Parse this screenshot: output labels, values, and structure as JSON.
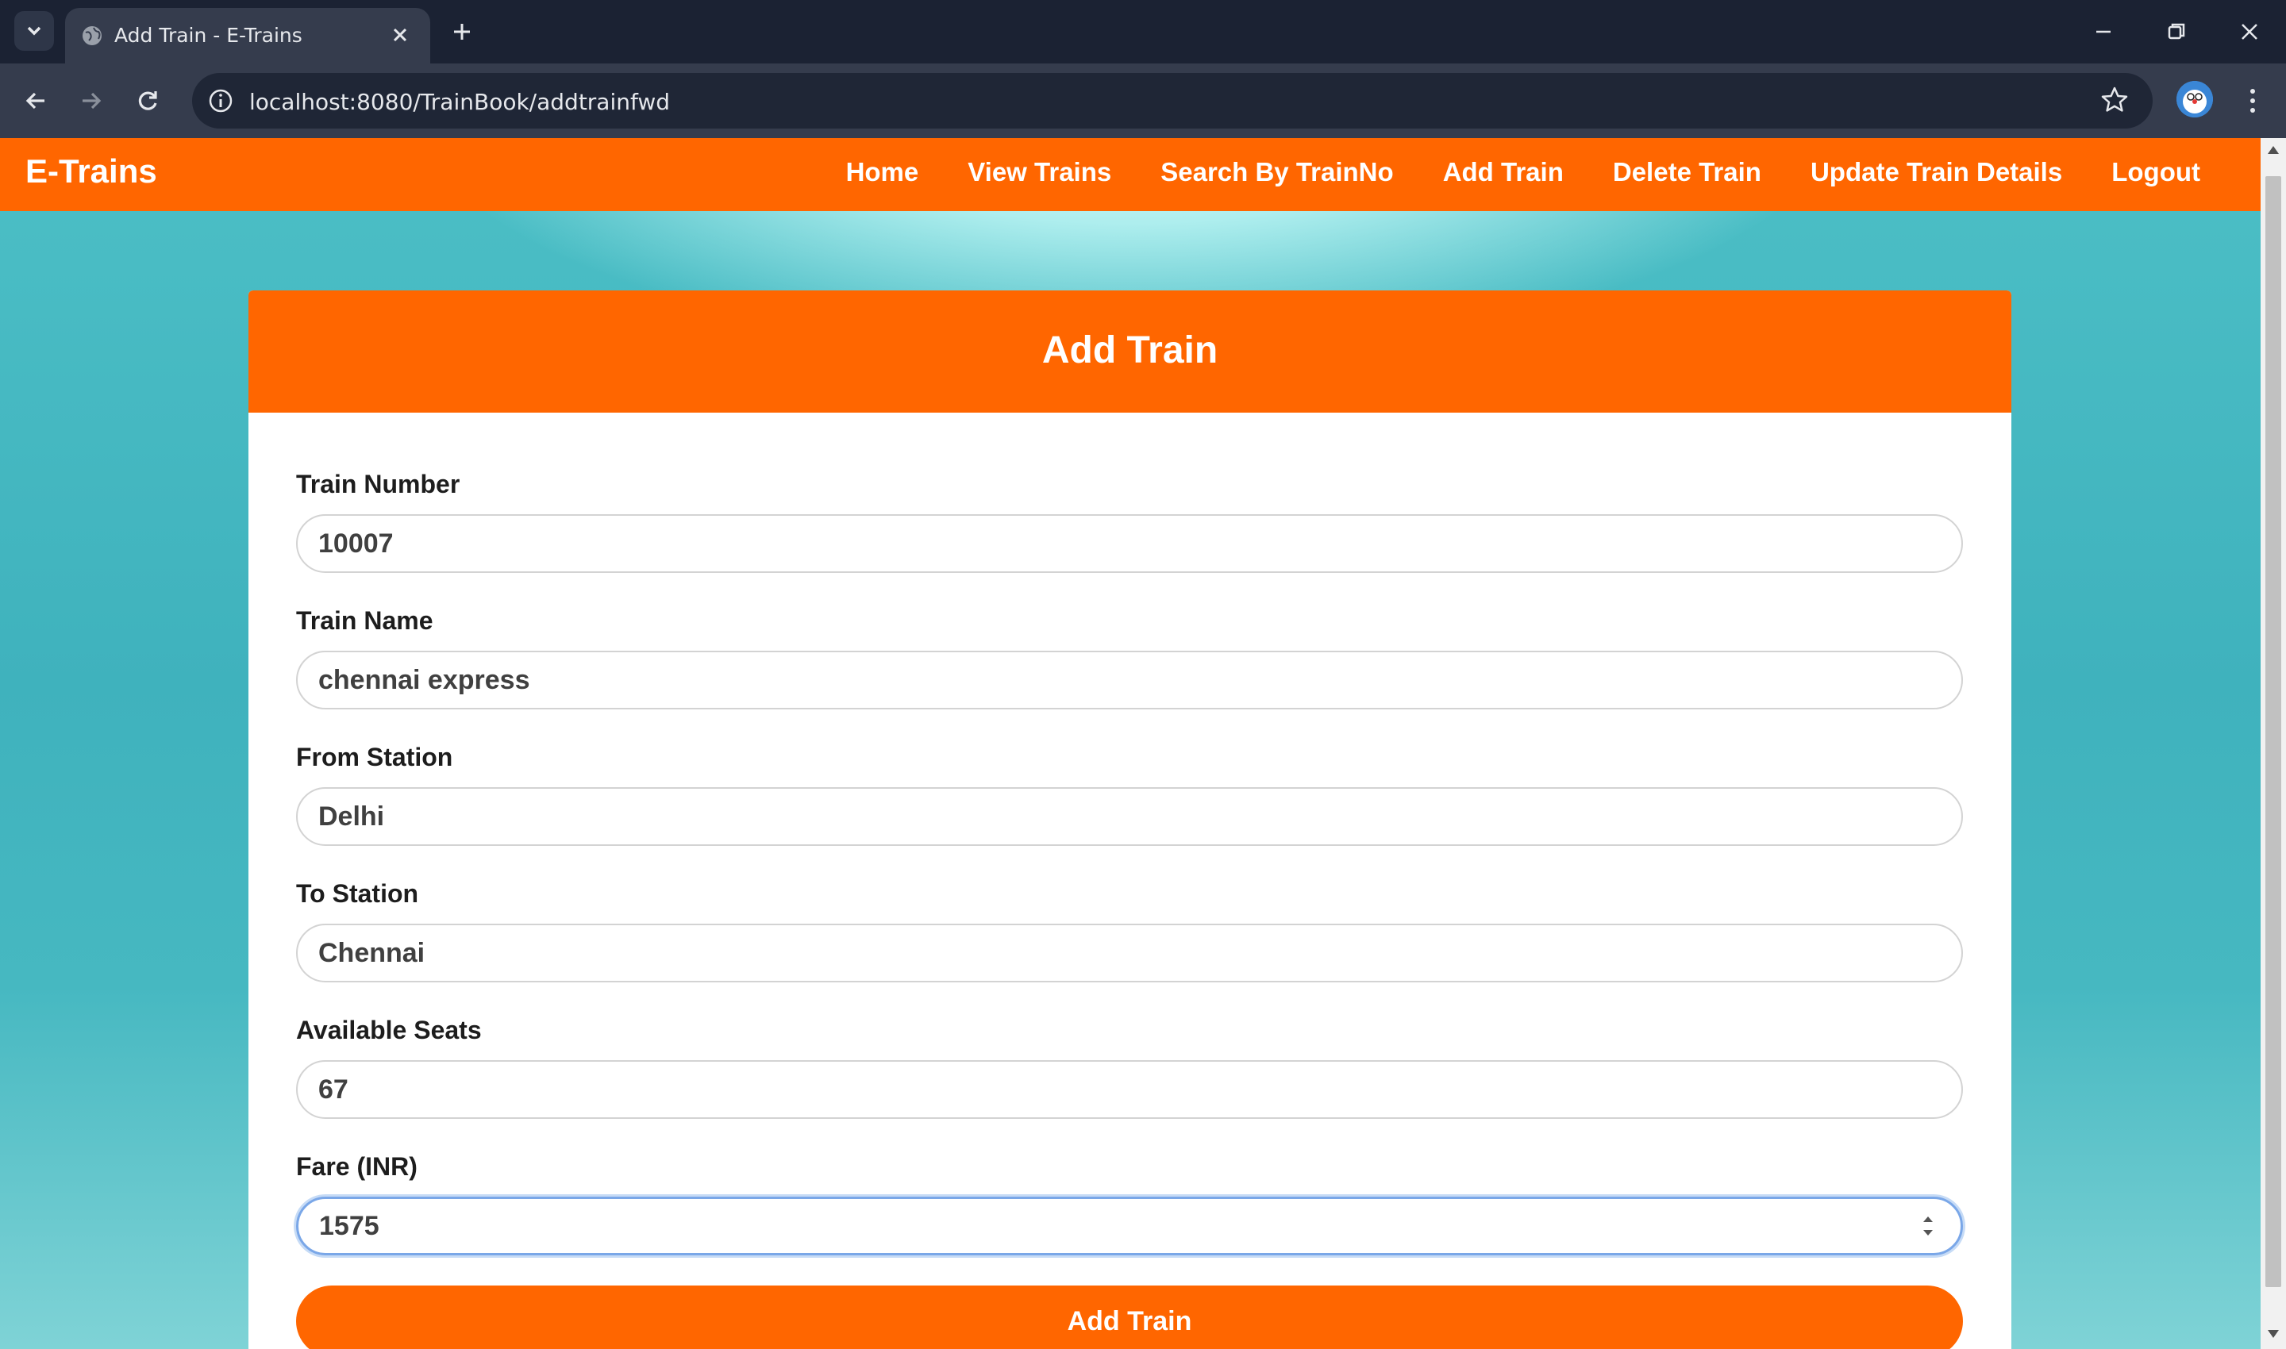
{
  "browser": {
    "tab_title": "Add Train - E-Trains",
    "url": "localhost:8080/TrainBook/addtrainfwd"
  },
  "site": {
    "brand": "E-Trains",
    "nav": [
      {
        "label": "Home"
      },
      {
        "label": "View Trains"
      },
      {
        "label": "Search By TrainNo"
      },
      {
        "label": "Add Train"
      },
      {
        "label": "Delete Train"
      },
      {
        "label": "Update Train Details"
      },
      {
        "label": "Logout"
      }
    ],
    "colors": {
      "accent": "#ff6600",
      "background": "#45b8c2"
    }
  },
  "form": {
    "title": "Add Train",
    "fields": [
      {
        "label": "Train Number",
        "value": "10007"
      },
      {
        "label": "Train Name",
        "value": "chennai express"
      },
      {
        "label": "From Station",
        "value": "Delhi"
      },
      {
        "label": "To Station",
        "value": "Chennai"
      },
      {
        "label": "Available Seats",
        "value": "67"
      },
      {
        "label": "Fare (INR)",
        "value": "1575"
      }
    ],
    "submit_label": "Add Train"
  }
}
